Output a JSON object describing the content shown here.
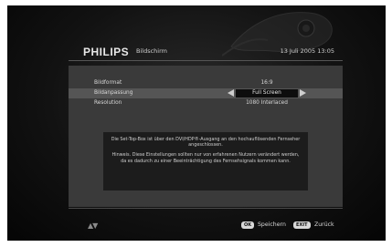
{
  "header": {
    "brand": "PHILIPS",
    "page_title": "Bildschirm",
    "datetime": "13 Juli 2005   13:05"
  },
  "settings": [
    {
      "label": "Bildformat",
      "value": "16:9",
      "selected": false
    },
    {
      "label": "Bildanpassung",
      "value": "Full Screen",
      "selected": true
    },
    {
      "label": "Resolution",
      "value": "1080 Interlaced",
      "selected": false
    }
  ],
  "info": {
    "paragraph1": "Die Set-Top-Box ist über den DVI/HDP®-Ausgang an den hochauflösenden Fernseher angeschlossen.",
    "paragraph2": "Hinweis. Diese Einstellungen sollten nur von erfahrenen Nutzern verändert werden, da es dadurch zu einer Beeinträchtigung des Fernsehsignals kommen kann."
  },
  "footer": {
    "ok_key": "OK",
    "ok_label": "Speichern",
    "exit_key": "EXIT",
    "exit_label": "Zurück"
  },
  "icons": {
    "nav": "up-down-arrows-icon",
    "left": "arrow-left-icon",
    "right": "arrow-right-icon"
  }
}
